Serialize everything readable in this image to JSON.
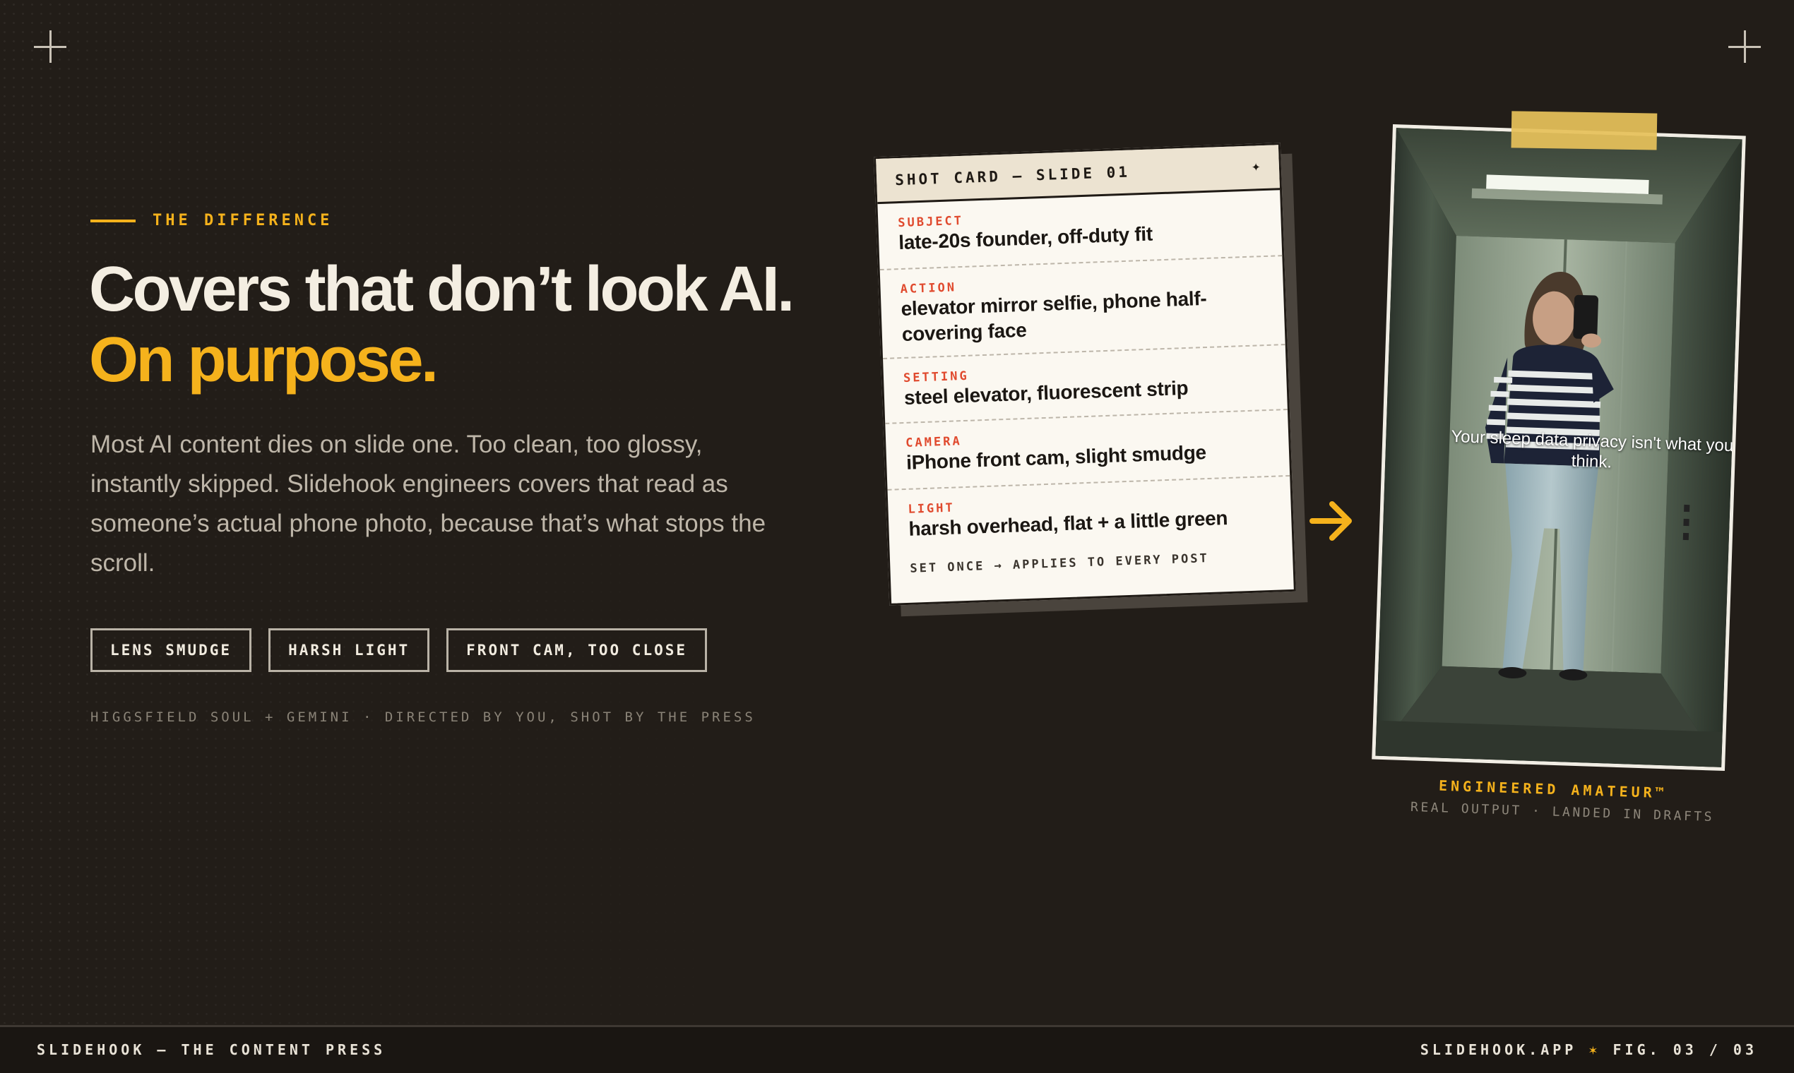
{
  "eyebrow": "THE DIFFERENCE",
  "headline": {
    "line1": "Covers that don’t look AI.",
    "line2": "On purpose."
  },
  "body": "Most AI content dies on slide one. Too clean, too glossy, instantly skipped. Slidehook engineers covers that read as someone’s actual phone photo, because that’s what stops the scroll.",
  "chips": [
    "LENS SMUDGE",
    "HARSH LIGHT",
    "FRONT CAM, TOO CLOSE"
  ],
  "credits": "HIGGSFIELD SOUL + GEMINI · DIRECTED BY YOU, SHOT BY THE PRESS",
  "shot_card": {
    "title": "SHOT CARD — SLIDE 01",
    "star": "✦",
    "rows": [
      {
        "label": "SUBJECT",
        "value": "late-20s founder, off-duty fit"
      },
      {
        "label": "ACTION",
        "value": "elevator mirror selfie, phone half-covering face"
      },
      {
        "label": "SETTING",
        "value": "steel elevator, fluorescent strip"
      },
      {
        "label": "CAMERA",
        "value": "iPhone front cam, slight smudge"
      },
      {
        "label": "LIGHT",
        "value": "harsh overhead, flat + a little green"
      }
    ],
    "footer": "SET ONCE → APPLIES TO EVERY POST"
  },
  "photo": {
    "overlay_text": "Your sleep data privacy isn't what you think."
  },
  "captions": {
    "title": "ENGINEERED AMATEUR™",
    "subtitle": "REAL OUTPUT · LANDED IN DRAFTS"
  },
  "footer": {
    "left": "SLIDEHOOK — THE CONTENT PRESS",
    "right_site": "SLIDEHOOK.APP",
    "right_star": "✶",
    "right_fig": "FIG. 03 / 03"
  },
  "colors": {
    "background": "#221d18",
    "accent": "#f5b21c",
    "card_label": "#e04a2e",
    "card_paper": "#fbf8f1"
  },
  "icons": [
    "plus-icon",
    "arrow-right-icon",
    "star-icon"
  ]
}
